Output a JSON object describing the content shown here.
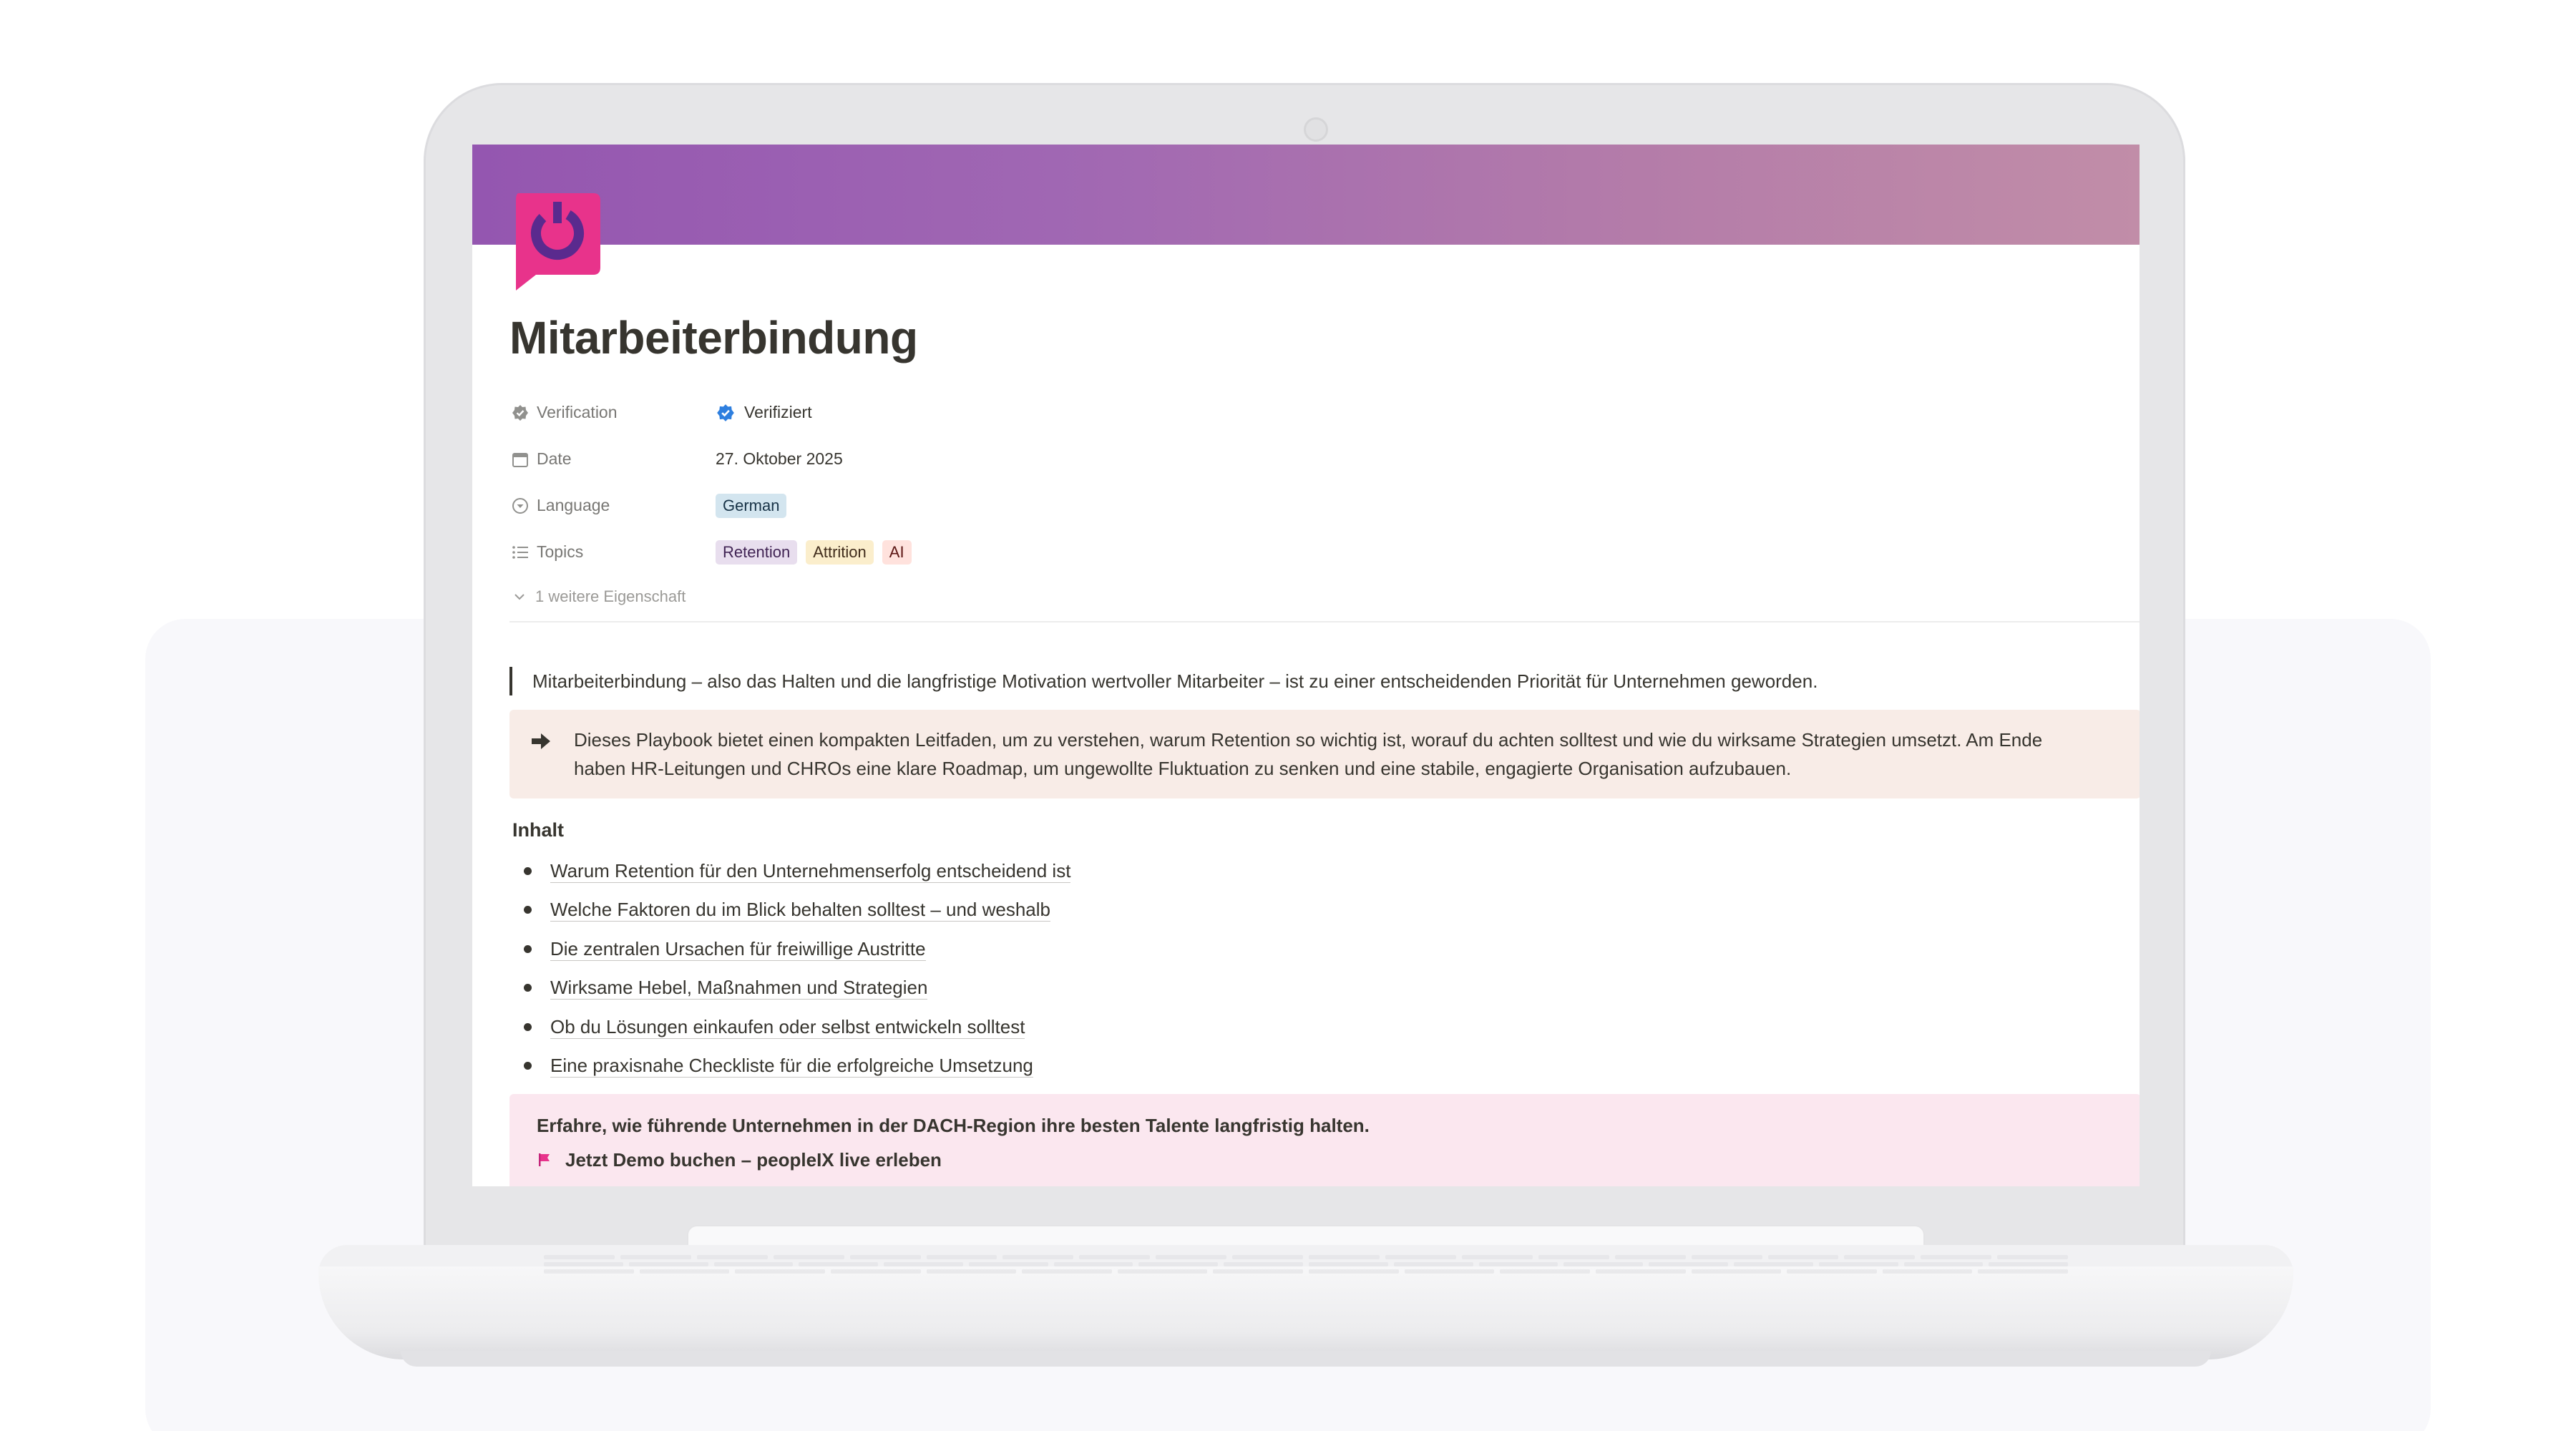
{
  "page": {
    "title": "Mitarbeiterbindung",
    "properties": {
      "verification": {
        "label": "Verification",
        "value": "Verifiziert"
      },
      "date": {
        "label": "Date",
        "value": "27. Oktober 2025"
      },
      "language": {
        "label": "Language",
        "tag": "German"
      },
      "topics": {
        "label": "Topics",
        "tags": [
          "Retention",
          "Attrition",
          "AI"
        ]
      },
      "more": "1 weitere Eigenschaft"
    },
    "quote": "Mitarbeiterbindung – also das Halten und die langfristige Motivation wertvoller Mitarbeiter – ist zu einer entscheidenden Priorität für Unternehmen geworden.",
    "callout": {
      "line1": "Dieses Playbook bietet einen kompakten Leitfaden, um zu verstehen, warum Retention so wichtig ist, worauf du achten solltest und wie du wirksame Strategien umsetzt. Am Ende",
      "line2": "haben HR-Leitungen und CHROs eine klare Roadmap, um ungewollte Fluktuation zu senken und eine stabile, engagierte Organisation aufzubauen."
    },
    "toc": {
      "heading": "Inhalt",
      "items": [
        "Warum Retention für den Unternehmenserfolg entscheidend ist",
        "Welche Faktoren du im Blick behalten solltest – und weshalb",
        "Die zentralen Ursachen für freiwillige Austritte",
        "Wirksame Hebel, Maßnahmen und Strategien",
        "Ob du Lösungen einkaufen oder selbst entwickeln solltest",
        "Eine praxisnahe Checkliste für die erfolgreiche Umsetzung"
      ]
    },
    "cta": {
      "title": "Erfahre, wie führende Unternehmen in der DACH-Region ihre besten Talente langfristig halten.",
      "link": "Jetzt Demo buchen – peopleIX live erleben"
    }
  },
  "colors": {
    "cover_start": "#9456b0",
    "cover_end": "#c18da8",
    "logo": "#e8338b",
    "verified_badge": "#2e7fdf",
    "callout_bg": "#f8ece7",
    "cta_bg": "#fbe7ef"
  },
  "icons": {
    "logo": "peopleix-logo",
    "verification": "verified-check-icon",
    "date": "calendar-icon",
    "language": "select-circle-icon",
    "topics": "list-icon",
    "more": "chevron-down-icon",
    "callout": "arrow-right-icon",
    "cta": "flag-icon"
  }
}
